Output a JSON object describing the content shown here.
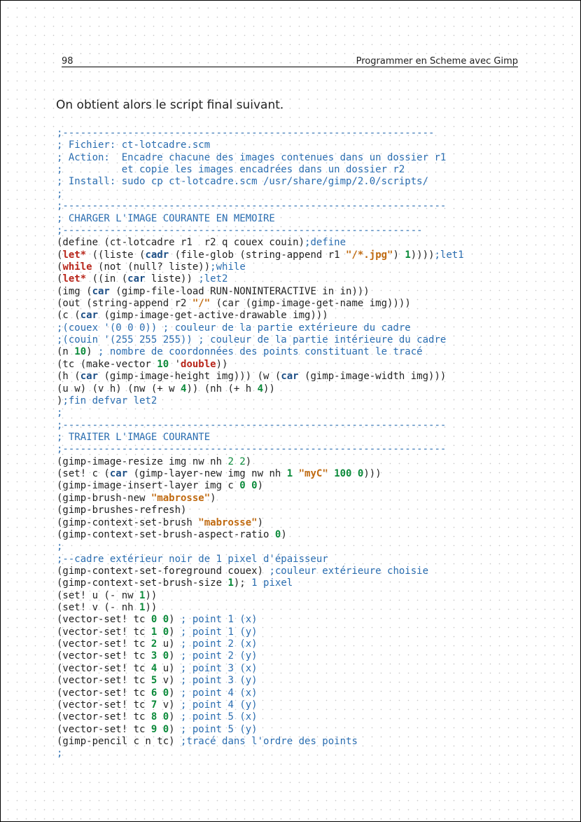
{
  "header": {
    "page_number": "98",
    "running_title": "Programmer en Scheme avec Gimp"
  },
  "intro": "On obtient alors le script final suivant.",
  "code_lines": [
    [
      [
        "c",
        ";---------------------------------------------------------------"
      ]
    ],
    [
      [
        "c",
        "; Fichier: ct-lotcadre.scm"
      ]
    ],
    [
      [
        "c",
        "; Action:  Encadre chacune des images contenues dans un dossier r1"
      ]
    ],
    [
      [
        "c",
        ";          et copie les images encadrées dans un dossier r2"
      ]
    ],
    [
      [
        "c",
        "; Install: sudo cp ct-lotcadre.scm /usr/share/gimp/2.0/scripts/"
      ]
    ],
    [
      [
        "c",
        ";"
      ]
    ],
    [
      [
        "c",
        ";-----------------------------------------------------------------"
      ]
    ],
    [
      [
        "c",
        "; CHARGER L'IMAGE COURANTE EN MEMOIRE"
      ]
    ],
    [
      [
        "c",
        ";-------------------------------------------------------------"
      ]
    ],
    [
      [
        "t",
        "(define (ct-lotcadre r1  r2 q couex couin)"
      ],
      [
        "c",
        ";define"
      ]
    ],
    [
      [
        "t",
        "("
      ],
      [
        "k",
        "let*"
      ],
      [
        "t",
        " ((liste ("
      ],
      [
        "b",
        "cadr"
      ],
      [
        "t",
        " (file-glob (string-append r1 "
      ],
      [
        "s",
        "\"/*.jpg\""
      ],
      [
        "t",
        ") "
      ],
      [
        "n",
        "1"
      ],
      [
        "t",
        "))))"
      ],
      [
        "c",
        ";let1"
      ]
    ],
    [
      [
        "t",
        "("
      ],
      [
        "k",
        "while"
      ],
      [
        "t",
        " (not (null? liste))"
      ],
      [
        "c",
        ";while"
      ]
    ],
    [
      [
        "t",
        "("
      ],
      [
        "k",
        "let*"
      ],
      [
        "t",
        " ((in ("
      ],
      [
        "b",
        "car"
      ],
      [
        "t",
        " liste)) "
      ],
      [
        "c",
        ";let2"
      ]
    ],
    [
      [
        "t",
        "(img ("
      ],
      [
        "b",
        "car"
      ],
      [
        "t",
        " (gimp-file-load RUN-NONINTERACTIVE in in)))"
      ]
    ],
    [
      [
        "t",
        "(out (string-append r2 "
      ],
      [
        "s",
        "\"/\""
      ],
      [
        "t",
        " (car (gimp-image-get-name img))))"
      ]
    ],
    [
      [
        "t",
        "(c ("
      ],
      [
        "b",
        "car"
      ],
      [
        "t",
        " (gimp-image-get-active-drawable img)))"
      ]
    ],
    [
      [
        "c",
        ";(couex '(0 0 0)) ; couleur de la partie extérieure du cadre"
      ]
    ],
    [
      [
        "c",
        ";(couin '(255 255 255)) ; couleur de la partie intérieure du cadre"
      ]
    ],
    [
      [
        "t",
        "(n "
      ],
      [
        "n",
        "10"
      ],
      [
        "t",
        ") "
      ],
      [
        "c",
        "; nombre de coordonnées des points constituant le tracé"
      ]
    ],
    [
      [
        "t",
        "(tc (make-vector "
      ],
      [
        "n",
        "10"
      ],
      [
        "t",
        " '"
      ],
      [
        "k",
        "double"
      ],
      [
        "t",
        "))"
      ]
    ],
    [
      [
        "t",
        "(h ("
      ],
      [
        "b",
        "car"
      ],
      [
        "t",
        " (gimp-image-height img))) (w ("
      ],
      [
        "b",
        "car"
      ],
      [
        "t",
        " (gimp-image-width img)))"
      ]
    ],
    [
      [
        "t",
        "(u w) (v h) (nw (+ w "
      ],
      [
        "n",
        "4"
      ],
      [
        "t",
        ")) (nh (+ h "
      ],
      [
        "n",
        "4"
      ],
      [
        "t",
        "))"
      ]
    ],
    [
      [
        "t",
        ")"
      ],
      [
        "c",
        ";fin defvar let2"
      ]
    ],
    [
      [
        "c",
        ";"
      ]
    ],
    [
      [
        "c",
        ";-----------------------------------------------------------------"
      ]
    ],
    [
      [
        "c",
        "; TRAITER L'IMAGE COURANTE"
      ]
    ],
    [
      [
        "c",
        ";-----------------------------------------------------------------"
      ]
    ],
    [
      [
        "t",
        "(gimp-image-resize img nw nh "
      ],
      [
        "nn",
        "2 2"
      ],
      [
        "t",
        ")"
      ]
    ],
    [
      [
        "t",
        "(set! c ("
      ],
      [
        "b",
        "car"
      ],
      [
        "t",
        " (gimp-layer-new img nw nh "
      ],
      [
        "n",
        "1"
      ],
      [
        "t",
        " "
      ],
      [
        "s",
        "\"myC\""
      ],
      [
        "t",
        " "
      ],
      [
        "n",
        "100 0"
      ],
      [
        "t",
        ")))"
      ]
    ],
    [
      [
        "t",
        "(gimp-image-insert-layer img c "
      ],
      [
        "n",
        "0 0"
      ],
      [
        "t",
        ")"
      ]
    ],
    [
      [
        "t",
        "(gimp-brush-new "
      ],
      [
        "s",
        "\"mabrosse\""
      ],
      [
        "t",
        ")"
      ]
    ],
    [
      [
        "t",
        "(gimp-brushes-refresh)"
      ]
    ],
    [
      [
        "t",
        "(gimp-context-set-brush "
      ],
      [
        "s",
        "\"mabrosse\""
      ],
      [
        "t",
        ")"
      ]
    ],
    [
      [
        "t",
        "(gimp-context-set-brush-aspect-ratio "
      ],
      [
        "n",
        "0"
      ],
      [
        "t",
        ")"
      ]
    ],
    [
      [
        "c",
        ";"
      ]
    ],
    [
      [
        "c",
        ";--cadre extérieur noir de 1 pixel d'épaisseur"
      ]
    ],
    [
      [
        "t",
        "(gimp-context-set-foreground couex) "
      ],
      [
        "c",
        ";couleur extérieure choisie"
      ]
    ],
    [
      [
        "t",
        "(gimp-context-set-brush-size "
      ],
      [
        "n",
        "1"
      ],
      [
        "t",
        "); "
      ],
      [
        "c",
        "1 pixel"
      ]
    ],
    [
      [
        "t",
        "(set! u (- nw "
      ],
      [
        "n",
        "1"
      ],
      [
        "t",
        "))"
      ]
    ],
    [
      [
        "t",
        "(set! v (- nh "
      ],
      [
        "n",
        "1"
      ],
      [
        "t",
        "))"
      ]
    ],
    [
      [
        "t",
        "(vector-set! tc "
      ],
      [
        "n",
        "0 0"
      ],
      [
        "t",
        ") "
      ],
      [
        "c",
        "; point 1 (x)"
      ]
    ],
    [
      [
        "t",
        "(vector-set! tc "
      ],
      [
        "n",
        "1 0"
      ],
      [
        "t",
        ") "
      ],
      [
        "c",
        "; point 1 (y)"
      ]
    ],
    [
      [
        "t",
        "(vector-set! tc "
      ],
      [
        "n",
        "2"
      ],
      [
        "t",
        " u) "
      ],
      [
        "c",
        "; point 2 (x)"
      ]
    ],
    [
      [
        "t",
        "(vector-set! tc "
      ],
      [
        "n",
        "3 0"
      ],
      [
        "t",
        ") "
      ],
      [
        "c",
        "; point 2 (y)"
      ]
    ],
    [
      [
        "t",
        "(vector-set! tc "
      ],
      [
        "n",
        "4"
      ],
      [
        "t",
        " u) "
      ],
      [
        "c",
        "; point 3 (x)"
      ]
    ],
    [
      [
        "t",
        "(vector-set! tc "
      ],
      [
        "n",
        "5"
      ],
      [
        "t",
        " v) "
      ],
      [
        "c",
        "; point 3 (y)"
      ]
    ],
    [
      [
        "t",
        "(vector-set! tc "
      ],
      [
        "n",
        "6 0"
      ],
      [
        "t",
        ") "
      ],
      [
        "c",
        "; point 4 (x)"
      ]
    ],
    [
      [
        "t",
        "(vector-set! tc "
      ],
      [
        "n",
        "7"
      ],
      [
        "t",
        " v) "
      ],
      [
        "c",
        "; point 4 (y)"
      ]
    ],
    [
      [
        "t",
        "(vector-set! tc "
      ],
      [
        "n",
        "8 0"
      ],
      [
        "t",
        ") "
      ],
      [
        "c",
        "; point 5 (x)"
      ]
    ],
    [
      [
        "t",
        "(vector-set! tc "
      ],
      [
        "n",
        "9 0"
      ],
      [
        "t",
        ") "
      ],
      [
        "c",
        "; point 5 (y)"
      ]
    ],
    [
      [
        "t",
        "(gimp-pencil c n tc) "
      ],
      [
        "c",
        ";tracé dans l'ordre des points"
      ]
    ],
    [
      [
        "c",
        ";"
      ]
    ]
  ]
}
